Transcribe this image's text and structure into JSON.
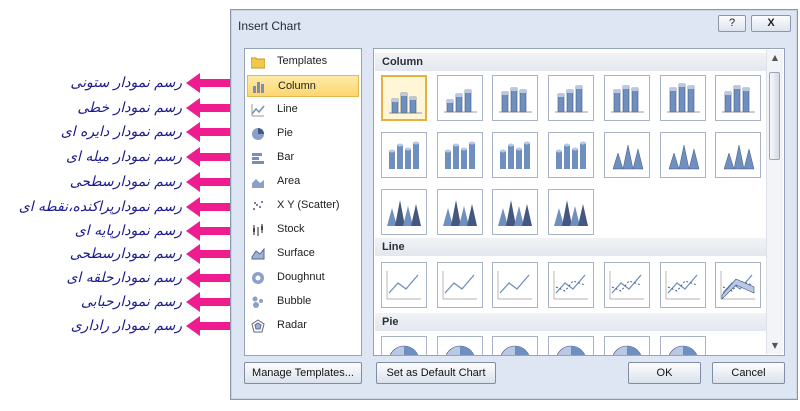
{
  "annotations": [
    "رسم نمودار ستونی",
    "رسم نمودار خطی",
    "رسم نمودار دایره ای",
    "رسم نمودار میله ای",
    "رسم نمودارسطحی",
    "رسم نمودارپراکنده،نقطه ای",
    "رسم نمودارپایه ای",
    "رسم نمودارسطحی",
    "رسم نمودارحلقه ای",
    "رسم نمودارحبابی",
    "رسم نمودار راداری"
  ],
  "dialog": {
    "title": "Insert Chart",
    "help_label": "?",
    "close_label": "X",
    "nav_items": [
      {
        "label": "Templates",
        "icon": "folder-icon"
      },
      {
        "label": "Column",
        "icon": "column-chart-icon",
        "selected": true
      },
      {
        "label": "Line",
        "icon": "line-chart-icon"
      },
      {
        "label": "Pie",
        "icon": "pie-chart-icon"
      },
      {
        "label": "Bar",
        "icon": "bar-chart-icon"
      },
      {
        "label": "Area",
        "icon": "area-chart-icon"
      },
      {
        "label": "X Y (Scatter)",
        "icon": "scatter-chart-icon"
      },
      {
        "label": "Stock",
        "icon": "stock-chart-icon"
      },
      {
        "label": "Surface",
        "icon": "surface-chart-icon"
      },
      {
        "label": "Doughnut",
        "icon": "doughnut-chart-icon"
      },
      {
        "label": "Bubble",
        "icon": "bubble-chart-icon"
      },
      {
        "label": "Radar",
        "icon": "radar-chart-icon"
      }
    ],
    "sections": {
      "column": "Column",
      "line": "Line",
      "pie": "Pie"
    },
    "buttons": {
      "manage_templates": "Manage Templates...",
      "set_default": "Set as Default Chart",
      "ok": "OK",
      "cancel": "Cancel"
    },
    "colors": {
      "accent_selection": "#fcd770",
      "annotation_text": "#1b1b8e",
      "annotation_arrow": "#ee1c8f",
      "chart_blue": "#6f8fbf"
    }
  }
}
